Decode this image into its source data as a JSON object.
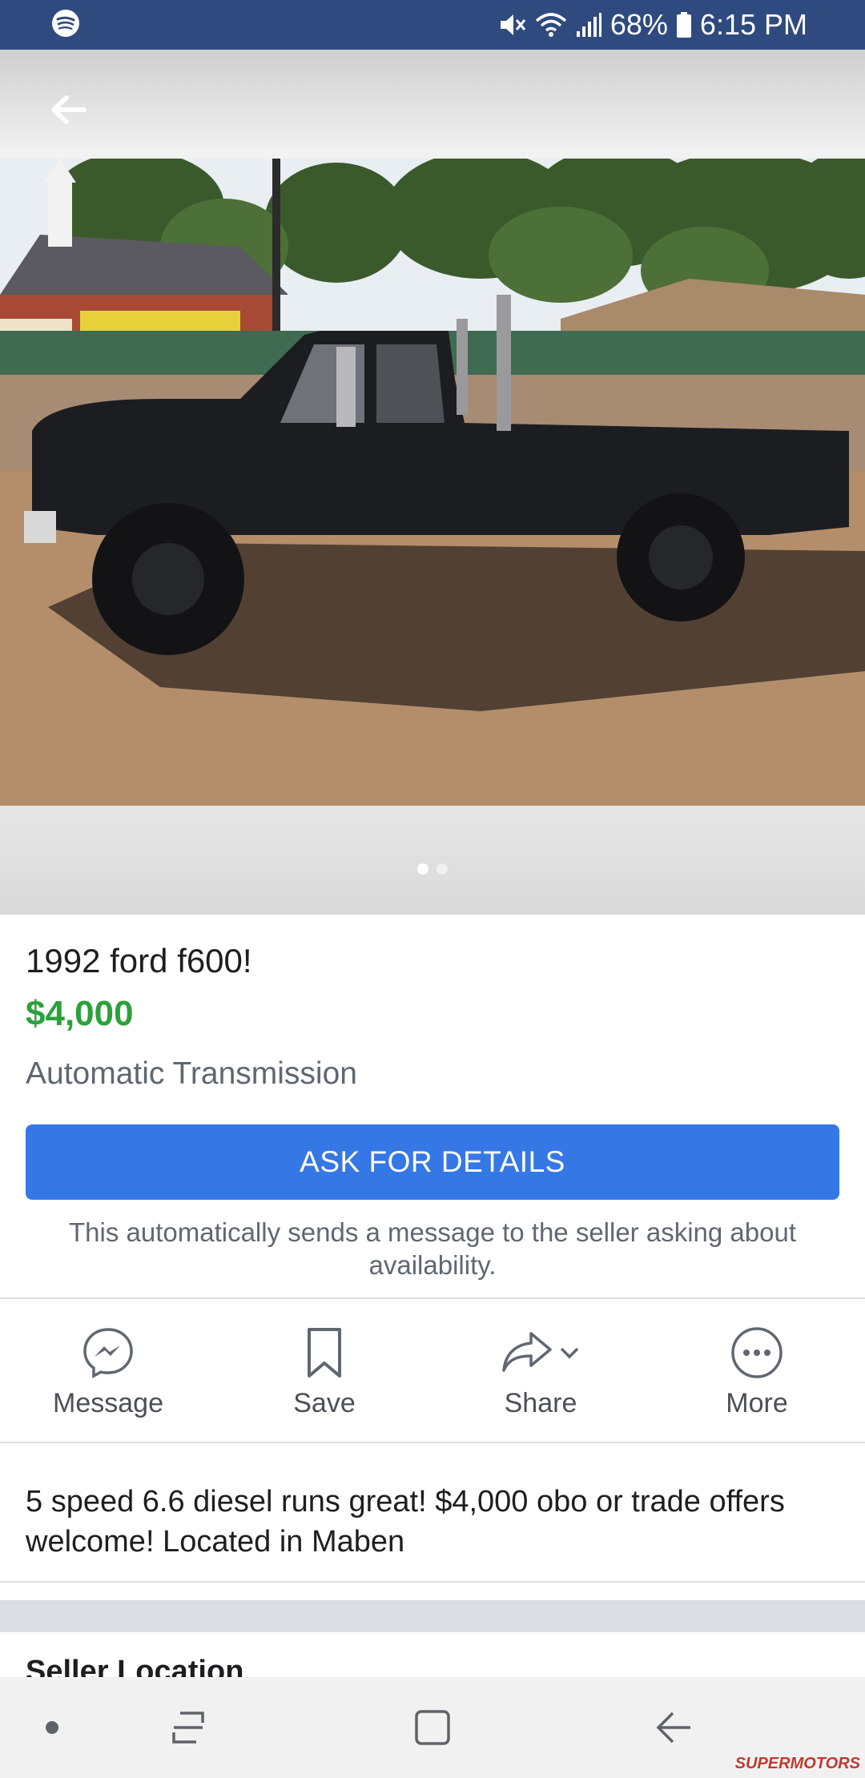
{
  "status_bar": {
    "battery": "68%",
    "time": "6:15 PM",
    "icons": [
      "spotify-icon",
      "mute-icon",
      "wifi-icon",
      "signal-icon",
      "battery-icon"
    ]
  },
  "photo": {
    "pager_total": 2,
    "pager_active": 1
  },
  "listing": {
    "title": "1992 ford f600!",
    "price": "$4,000",
    "subtitle": "Automatic Transmission",
    "ask_button": "ASK FOR DETAILS",
    "ask_note": "This automatically sends a message to the seller asking about availability."
  },
  "actions": [
    {
      "label": "Message",
      "icon": "messenger-icon"
    },
    {
      "label": "Save",
      "icon": "bookmark-icon"
    },
    {
      "label": "Share",
      "icon": "share-icon"
    },
    {
      "label": "More",
      "icon": "more-icon"
    }
  ],
  "description": "5 speed 6.6 diesel runs great! $4,000 obo or trade offers welcome! Located in Maben",
  "section": {
    "title": "Seller Location"
  },
  "watermark": "SUPERMOTORS",
  "colors": {
    "status_bar": "#2f4a7e",
    "price": "#2aa13a",
    "button": "#3578e5"
  }
}
